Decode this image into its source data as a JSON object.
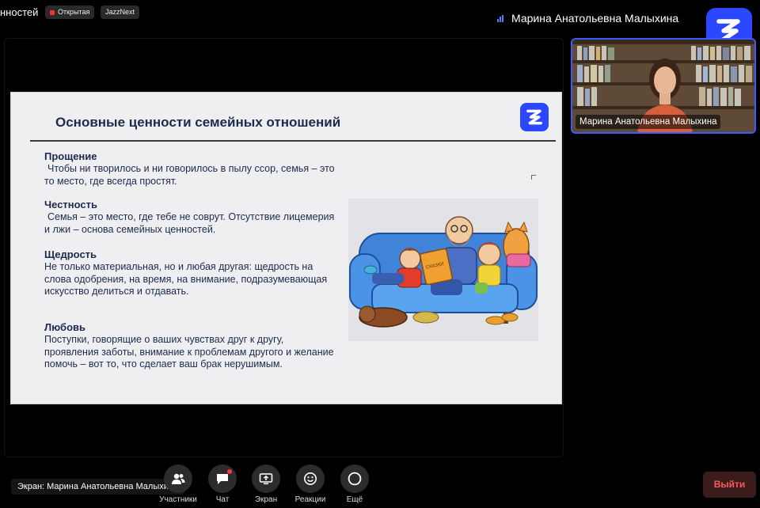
{
  "header": {
    "meeting_title": "нностей",
    "open_badge": "Открытая",
    "app_badge": "JazzNext",
    "active_speaker": "Марина Анатольевна Малыхина"
  },
  "slide": {
    "title": "Основные ценности семейных отношений",
    "sections": [
      {
        "heading": "Прощение",
        "text": "Чтобы ни творилось и ни говорилось в пылу ссор, семья – это то место, где всегда простят."
      },
      {
        "heading": "Честность",
        "text": "Семья – это место, где тебе не соврут. Отсутствие лицемерия и лжи – основа семейных ценностей."
      },
      {
        "heading": "Щедрость",
        "text": "Не только материальная, но и любая другая: щедрость на слова одобрения, на время, на внимание, подразумевающая искусство делиться и отдавать."
      },
      {
        "heading": "Любовь",
        "text": "Поступки, говорящие о ваших чувствах друг к другу, проявления заботы, внимание к проблемам другого и желание помочь – вот то, что сделает ваш брак нерушимым."
      }
    ],
    "book_label": "СКАЗКИ"
  },
  "stage": {
    "screen_share_label": "Экран: Марина Анатольевна Малыхина"
  },
  "participant": {
    "name": "Марина Анатольевна Малыхина"
  },
  "toolbar": {
    "participants": "Участники",
    "chat": "Чат",
    "screen": "Экран",
    "reactions": "Реакции",
    "more": "Ещё",
    "leave": "Выйти"
  },
  "colors": {
    "brand": "#2b47ff",
    "slide_title": "#1d2a4e",
    "leave_text": "#ff5a5a",
    "notification": "#ff3b3b"
  }
}
